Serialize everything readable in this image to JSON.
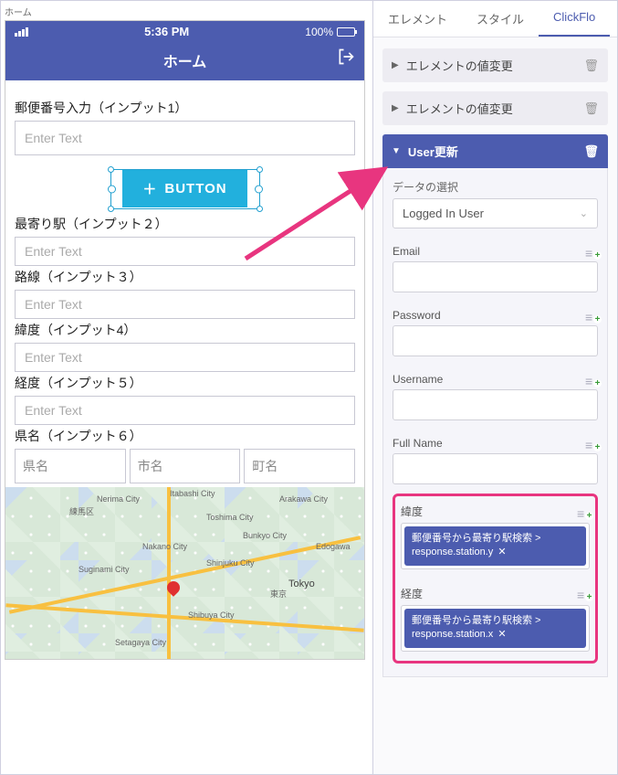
{
  "breadcrumb": "ホーム",
  "phone": {
    "time": "5:36 PM",
    "battery": "100%",
    "title": "ホーム",
    "postal_label": "郵便番号入力（インプット1）",
    "placeholder": "Enter Text",
    "button_label": "BUTTON",
    "station_label": "最寄り駅（インプット２）",
    "line_label": "路線（インプット３）",
    "lat_label": "緯度（インプット4）",
    "lon_label": "経度（インプット５）",
    "pref_title": "県名（インプット６）",
    "pref_ph": "県名",
    "city_ph": "市名",
    "town_ph": "町名",
    "map_labels": [
      "Nerima City",
      "Toshima City",
      "Nakano City",
      "Suginami City",
      "Shinjuku City",
      "Shibuya City",
      "Bunkyo City",
      "Arakawa City",
      "Tokyo",
      "Edogawa",
      "Itabashi City",
      "Setagaya City",
      "練馬区",
      "東京"
    ]
  },
  "tabs": {
    "elements": "エレメント",
    "style": "スタイル",
    "clickflow": "ClickFlo"
  },
  "panel": {
    "collapse1": "エレメントの値変更",
    "collapse2": "エレメントの値変更",
    "expanded_title": "User更新",
    "data_select_label": "データの選択",
    "data_select_value": "Logged In User",
    "fields": {
      "email": "Email",
      "password": "Password",
      "username": "Username",
      "fullname": "Full Name",
      "lat": "緯度",
      "lon": "経度"
    },
    "chip_lat": "郵便番号から最寄り駅検索 > response.station.y",
    "chip_lon": "郵便番号から最寄り駅検索 > response.station.x"
  }
}
